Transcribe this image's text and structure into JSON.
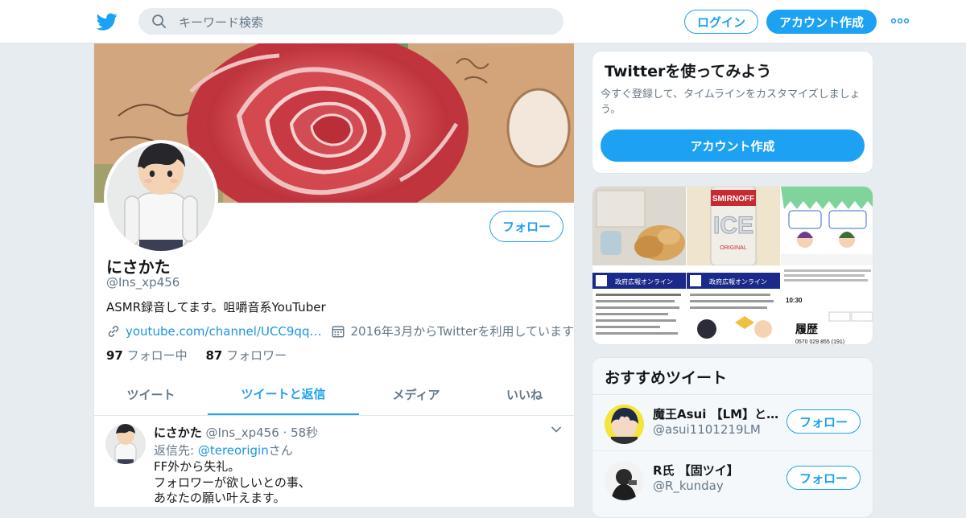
{
  "colors": {
    "accent": "#1da1f2",
    "link": "#1b95e0",
    "muted": "#657786",
    "background": "#e6ecf0"
  },
  "topbar": {
    "logo_icon": "twitter-bird-icon",
    "search_placeholder": "キーワード検索",
    "login_label": "ログイン",
    "signup_label": "アカウント作成",
    "more_icon": "more-dots-icon"
  },
  "profile": {
    "name": "にさかた",
    "handle": "@Ins_xp456",
    "bio": "ASMR録音してます。咀嚼音系YouTuber",
    "link": "youtube.com/channel/UCC9qq…",
    "joined": "2016年3月からTwitterを利用しています",
    "following_count": "97",
    "following_label": "フォロー中",
    "followers_count": "87",
    "followers_label": "フォロワー",
    "follow_label": "フォロー"
  },
  "tabs": [
    {
      "label": "ツイート"
    },
    {
      "label": "ツイートと返信"
    },
    {
      "label": "メディア"
    },
    {
      "label": "いいね"
    }
  ],
  "tweet": {
    "name": "にさかた",
    "meta": "@Ins_xp456 · 58秒",
    "reply_prefix": "返信先: ",
    "reply_mention": "@tereorigin",
    "reply_suffix": "さん",
    "lines": [
      "FF外から失礼。",
      "フォロワーが欲しいとの事、",
      "あなたの願い叶えます。"
    ]
  },
  "promo": {
    "title": "Twitterを使ってみよう",
    "description": "今すぐ登録して、タイムラインをカスタマイズしましょう。",
    "cta": "アカウント作成"
  },
  "media_thumbs": [
    {
      "icon": "photo-fried-food-icon",
      "text": ""
    },
    {
      "icon": "photo-smirnoff-ice-icon",
      "text": "SMIRNOFF ICE"
    },
    {
      "icon": "illustration-tickets-icon",
      "text": ""
    },
    {
      "icon": "doc-gov-pr-icon",
      "text": "政府広報オンライン"
    },
    {
      "icon": "doc-gov-pr-icon",
      "text": "政府広報オンライン"
    },
    {
      "icon": "phone-history-icon",
      "text": "履歴"
    }
  ],
  "recommendations": {
    "title": "おすすめツイート",
    "items": [
      {
        "name": "魔王Asui 【LM】と…",
        "handle": "@asui1101219LM",
        "follow_label": "フォロー"
      },
      {
        "name": "R氏 【固ツイ】",
        "handle": "@R_kunday",
        "follow_label": "フォロー"
      }
    ]
  }
}
